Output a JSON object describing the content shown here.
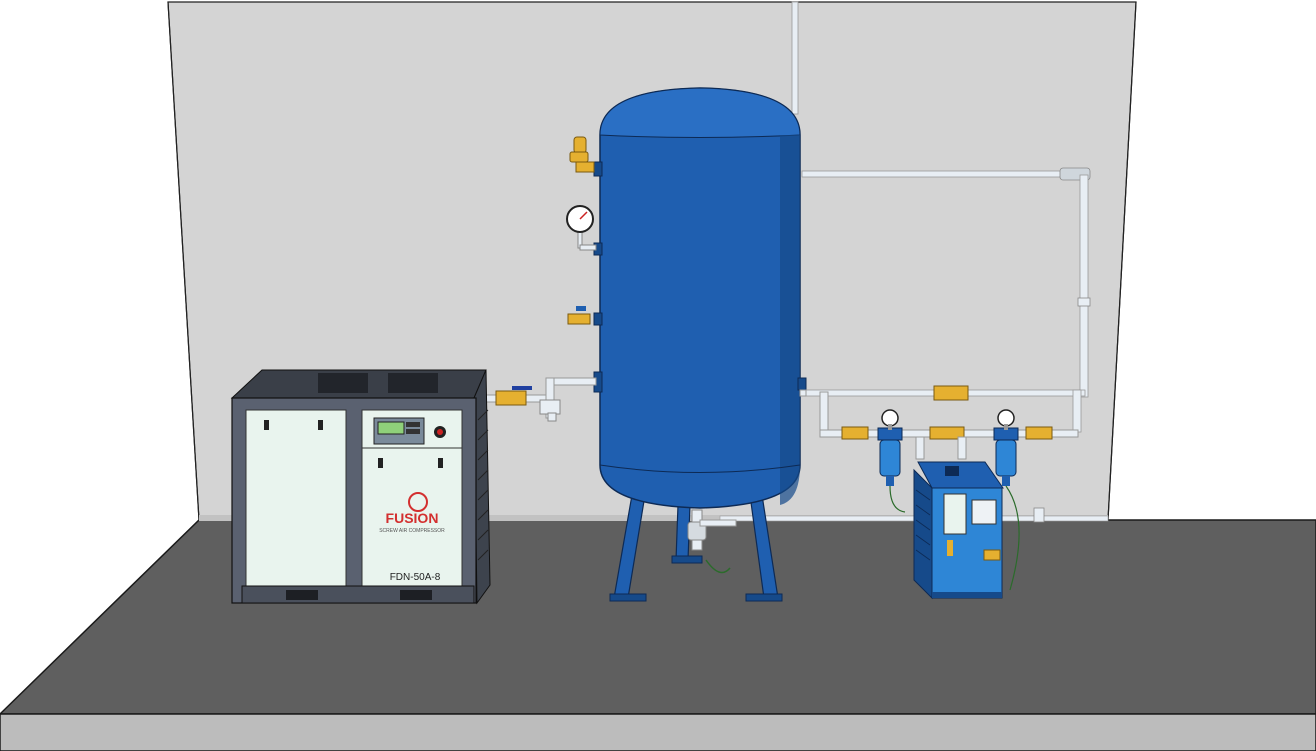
{
  "compressor": {
    "brand_name": "FUSION",
    "brand_subtitle": "SCREW AIR COMPRESSOR",
    "model": "FDN-50A-8",
    "display_panel": "control-panel"
  },
  "colors": {
    "wall": "#d4d4d4",
    "floor_top": "#5f5f5f",
    "floor_side": "#bcbcbc",
    "tank": "#1f5fb0",
    "tank_dark": "#164a8a",
    "pipe": "#e8eef4",
    "valve_brass": "#e5b030",
    "compressor_frame": "#5a6170",
    "compressor_panel": "#e9f4ee",
    "brand_red": "#d32f2f",
    "dryer_blue": "#2e86d6"
  },
  "icons": {
    "pressure_gauge": "pressure-gauge-icon",
    "safety_valve": "safety-valve-icon",
    "ball_valve": "ball-valve-icon",
    "filter": "filter-housing-icon"
  }
}
